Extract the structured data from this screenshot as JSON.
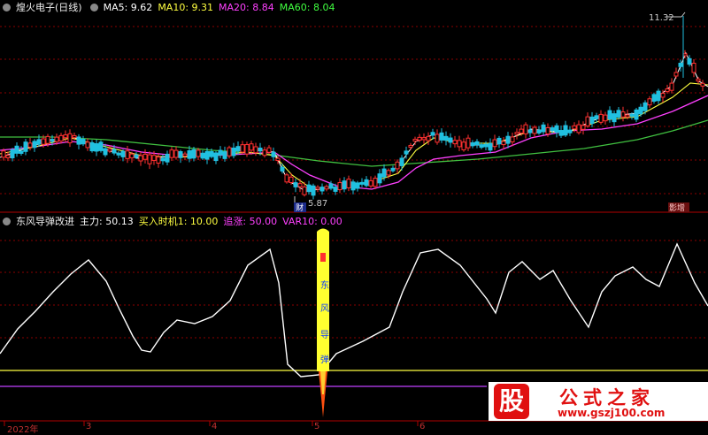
{
  "top_panel": {
    "title": "煌火电子(日线)",
    "indicators": [
      {
        "label": "MA5: 9.62",
        "color": "#ffffff"
      },
      {
        "label": "MA10: 9.31",
        "color": "#ffff40"
      },
      {
        "label": "MA20: 8.84",
        "color": "#ff40ff"
      },
      {
        "label": "MA60: 8.04",
        "color": "#40ff40"
      }
    ],
    "high_label": "11.32",
    "low_label": "5.87",
    "marker_left": "财",
    "marker_right": "影增"
  },
  "bottom_panel": {
    "title": "东风导弹改进",
    "indicators": [
      {
        "label": "主力: 50.13",
        "color": "#ffffff"
      },
      {
        "label": "买入时机1: 10.00",
        "color": "#ffff40"
      },
      {
        "label": "追涨: 50.00",
        "color": "#ff40ff"
      },
      {
        "label": "VAR10: 0.00",
        "color": "#ff40ff"
      }
    ],
    "missile_text": [
      "东",
      "风",
      "导",
      "弹"
    ]
  },
  "x_axis": [
    "2022年",
    "3",
    "4",
    "5",
    "6"
  ],
  "watermark": {
    "logo_char": "股",
    "brand": "公式之家",
    "url": "www.gszj100.com"
  },
  "colors": {
    "background": "#000000",
    "rise": "#ff3030",
    "fall": "#20c0e0",
    "grid": "#8b0000"
  }
}
